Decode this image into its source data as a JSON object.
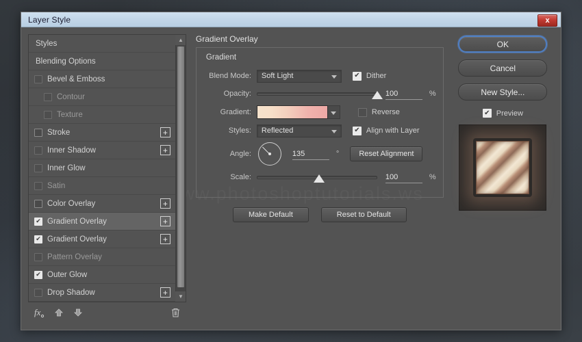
{
  "window": {
    "title": "Layer Style",
    "close_label": "x"
  },
  "styles_panel": {
    "items": [
      {
        "label": "Styles",
        "type": "header",
        "checkbox": "none",
        "plus": false,
        "selected": false,
        "dim": false
      },
      {
        "label": "Blending Options",
        "type": "header",
        "checkbox": "none",
        "plus": false,
        "selected": false,
        "dim": false
      },
      {
        "label": "Bevel & Emboss",
        "type": "normal",
        "checkbox": "faded",
        "plus": false,
        "selected": false,
        "dim": false
      },
      {
        "label": "Contour",
        "type": "sub",
        "checkbox": "faded",
        "plus": false,
        "selected": false,
        "dim": true
      },
      {
        "label": "Texture",
        "type": "sub",
        "checkbox": "faded",
        "plus": false,
        "selected": false,
        "dim": true
      },
      {
        "label": "Stroke",
        "type": "normal",
        "checkbox": "empty",
        "plus": true,
        "selected": false,
        "dim": false
      },
      {
        "label": "Inner Shadow",
        "type": "normal",
        "checkbox": "faded",
        "plus": true,
        "selected": false,
        "dim": false
      },
      {
        "label": "Inner Glow",
        "type": "normal",
        "checkbox": "faded",
        "plus": false,
        "selected": false,
        "dim": false
      },
      {
        "label": "Satin",
        "type": "normal",
        "checkbox": "faded",
        "plus": false,
        "selected": false,
        "dim": true
      },
      {
        "label": "Color Overlay",
        "type": "normal",
        "checkbox": "empty",
        "plus": true,
        "selected": false,
        "dim": false
      },
      {
        "label": "Gradient Overlay",
        "type": "normal",
        "checkbox": "checked",
        "plus": true,
        "selected": true,
        "dim": false
      },
      {
        "label": "Gradient Overlay",
        "type": "normal",
        "checkbox": "checked",
        "plus": true,
        "selected": false,
        "dim": false
      },
      {
        "label": "Pattern Overlay",
        "type": "normal",
        "checkbox": "faded",
        "plus": false,
        "selected": false,
        "dim": true
      },
      {
        "label": "Outer Glow",
        "type": "normal",
        "checkbox": "checked",
        "plus": false,
        "selected": false,
        "dim": false
      },
      {
        "label": "Drop Shadow",
        "type": "normal",
        "checkbox": "faded",
        "plus": true,
        "selected": false,
        "dim": false
      }
    ],
    "toolbar": {
      "fx_label": "fx",
      "move_up_label": "▲",
      "move_down_label": "▼",
      "delete_label": "🗑"
    },
    "scrollbar": {
      "up_label": "▲",
      "down_label": "▼"
    }
  },
  "main_panel": {
    "section_title": "Gradient Overlay",
    "legend": "Gradient",
    "labels": {
      "blend_mode": "Blend Mode:",
      "opacity": "Opacity:",
      "gradient": "Gradient:",
      "style": "Styles:",
      "angle": "Angle:",
      "scale": "Scale:"
    },
    "values": {
      "blend_mode": "Soft Light",
      "opacity": "100",
      "opacity_unit": "%",
      "style": "Reflected",
      "angle": "135",
      "angle_unit": "°",
      "scale": "100",
      "scale_unit": "%"
    },
    "checkboxes": {
      "dither": {
        "label": "Dither",
        "checked": true
      },
      "reverse": {
        "label": "Reverse",
        "checked": false
      },
      "align_with_layer": {
        "label": "Align with Layer",
        "checked": true
      }
    },
    "buttons": {
      "reset_alignment": "Reset Alignment",
      "make_default": "Make Default",
      "reset_to_default": "Reset to Default"
    },
    "gradient_colors": {
      "start": "#f6e2cc",
      "mid": "#f3cdbc",
      "end": "#eda8a5"
    }
  },
  "actions_panel": {
    "ok": "OK",
    "cancel": "Cancel",
    "new_style": "New Style...",
    "preview": {
      "label": "Preview",
      "checked": true
    }
  },
  "watermark": {
    "text": "www.photoshoptutorials.ws"
  },
  "theme": {
    "accent_blue": "#4f7fc4",
    "dialog_bg": "#535353",
    "titlebar_bg": "#c2d6e8",
    "close_red": "#c23b32"
  }
}
